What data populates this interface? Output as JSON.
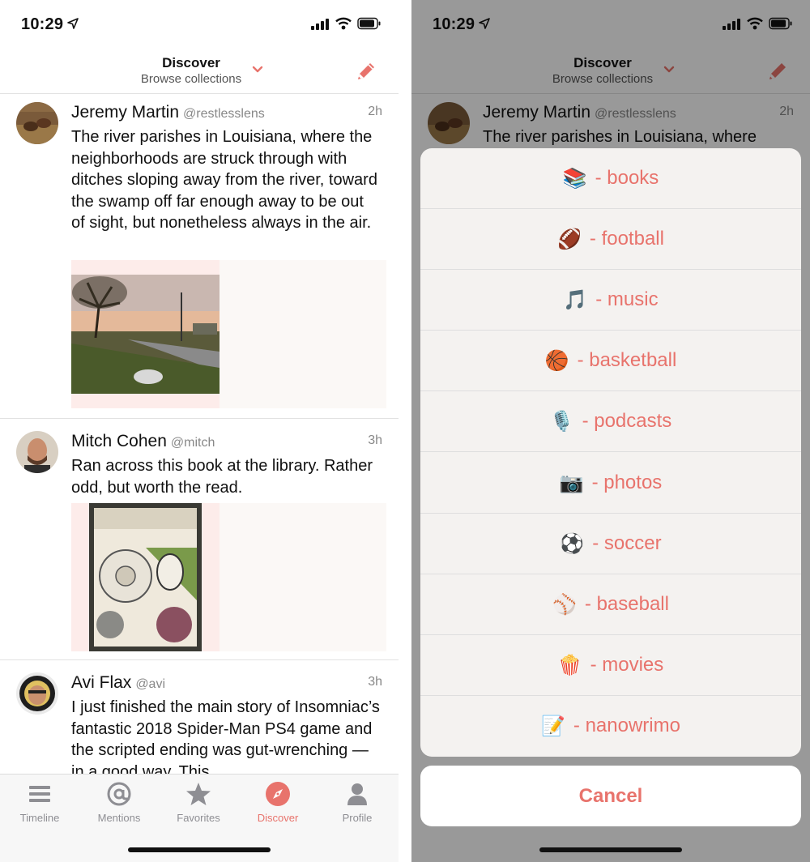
{
  "status_bar": {
    "time": "10:29"
  },
  "header": {
    "title": "Discover",
    "subtitle": "Browse collections"
  },
  "posts": [
    {
      "name": "Jeremy Martin",
      "handle": "@restlesslens",
      "time": "2h",
      "text": "The river parishes in Louisiana, where the neighborhoods are struck through with ditches sloping away from the river, toward the swamp off far enough away to be out of sight, but nonetheless always in the air."
    },
    {
      "name": "Mitch Cohen",
      "handle": "@mitch",
      "time": "3h",
      "text": "Ran across this book at the library. Rather odd, but worth the read."
    },
    {
      "name": "Avi Flax",
      "handle": "@avi",
      "time": "3h",
      "text": "I just finished the main story of Insomniac’s fantastic 2018 Spider-Man PS4 game and the scripted ending was gut-wrenching — in a good way. This"
    }
  ],
  "tabs": [
    {
      "label": "Timeline",
      "icon": "timeline-icon"
    },
    {
      "label": "Mentions",
      "icon": "at-sign-icon"
    },
    {
      "label": "Favorites",
      "icon": "star-icon"
    },
    {
      "label": "Discover",
      "icon": "compass-icon",
      "active": true
    },
    {
      "label": "Profile",
      "icon": "person-icon"
    }
  ],
  "right_preview": {
    "name": "Jeremy Martin",
    "handle": "@restlesslens",
    "time": "2h",
    "text": "The river parishes in Louisiana, where"
  },
  "collections_sheet": {
    "items": [
      {
        "emoji": "📚",
        "label": "- books"
      },
      {
        "emoji": "🏈",
        "label": "- football"
      },
      {
        "emoji": "🎵",
        "label": "- music"
      },
      {
        "emoji": "🏀",
        "label": "- basketball"
      },
      {
        "emoji": "🎙️",
        "label": "- podcasts"
      },
      {
        "emoji": "📷",
        "label": "- photos"
      },
      {
        "emoji": "⚽",
        "label": "- soccer"
      },
      {
        "emoji": "⚾",
        "label": "- baseball"
      },
      {
        "emoji": "🍿",
        "label": "- movies"
      },
      {
        "emoji": "📝",
        "label": "- nanowrimo"
      }
    ],
    "cancel_label": "Cancel"
  },
  "colors": {
    "accent": "#e8736c",
    "muted": "#8e8e93",
    "divider": "#e2e2e2"
  }
}
